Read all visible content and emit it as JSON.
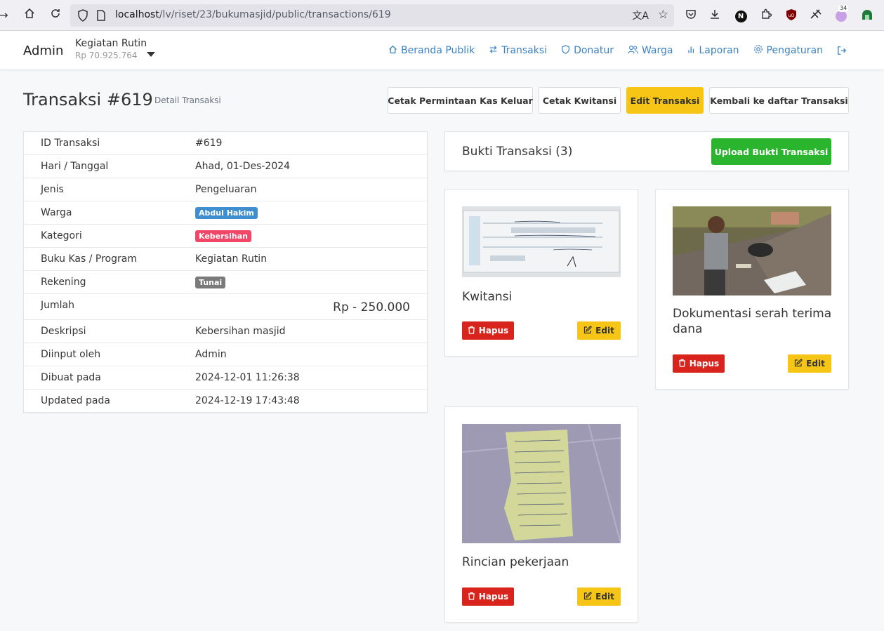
{
  "browser": {
    "url_host": "localhost",
    "url_path": "/lv/riset/23/bukumasjid/public/transactions/619",
    "notif_count": "34"
  },
  "nav": {
    "brand": "Admin",
    "book_name": "Kegiatan Rutin",
    "book_balance": "Rp 70.925.764",
    "links": [
      {
        "label": "Beranda Publik",
        "icon": "home-icon"
      },
      {
        "label": "Transaksi",
        "icon": "swap-icon"
      },
      {
        "label": "Donatur",
        "icon": "shield-icon"
      },
      {
        "label": "Warga",
        "icon": "users-icon"
      },
      {
        "label": "Laporan",
        "icon": "bar-chart-icon"
      },
      {
        "label": "Pengaturan",
        "icon": "gear-icon"
      }
    ]
  },
  "header": {
    "title": "Transaksi #619",
    "subtitle": "Detail Transaksi",
    "buttons": {
      "print_request": "Cetak Permintaan Kas Keluar",
      "print_receipt": "Cetak Kwitansi",
      "edit": "Edit Transaksi",
      "back": "Kembali ke daftar Transaksi"
    }
  },
  "details": {
    "rows": [
      {
        "label": "ID Transaksi",
        "value": "#619"
      },
      {
        "label": "Hari / Tanggal",
        "value": "Ahad, 01-Des-2024"
      },
      {
        "label": "Jenis",
        "value": "Pengeluaran"
      },
      {
        "label": "Warga",
        "value": "Abdul Hakim"
      },
      {
        "label": "Kategori",
        "value": "Kebersihan"
      },
      {
        "label": "Buku Kas / Program",
        "value": "Kegiatan Rutin"
      },
      {
        "label": "Rekening",
        "value": "Tunai"
      },
      {
        "label": "Jumlah",
        "value": "Rp - 250.000"
      },
      {
        "label": "Deskripsi",
        "value": "Kebersihan masjid"
      },
      {
        "label": "Diinput oleh",
        "value": "Admin"
      },
      {
        "label": "Dibuat pada",
        "value": "2024-12-01 11:26:38"
      },
      {
        "label": "Updated pada",
        "value": "2024-12-19 17:43:48"
      }
    ],
    "tag_colors": {
      "warga": "#3e8ed0",
      "kategori": "#f14668",
      "rekening": "#7a7a7a"
    }
  },
  "evidence": {
    "title": "Bukti Transaksi (3)",
    "upload_label": "Upload Bukti Transaksi",
    "delete_label": "Hapus",
    "edit_label": "Edit",
    "items": [
      {
        "caption": "Kwitansi"
      },
      {
        "caption": "Dokumentasi serah terima dana"
      },
      {
        "caption": "Rincian pekerjaan"
      }
    ]
  },
  "colors": {
    "link": "#3b82c4",
    "warning": "#f7c515",
    "danger": "#d9231d",
    "success": "#2bb52f"
  }
}
